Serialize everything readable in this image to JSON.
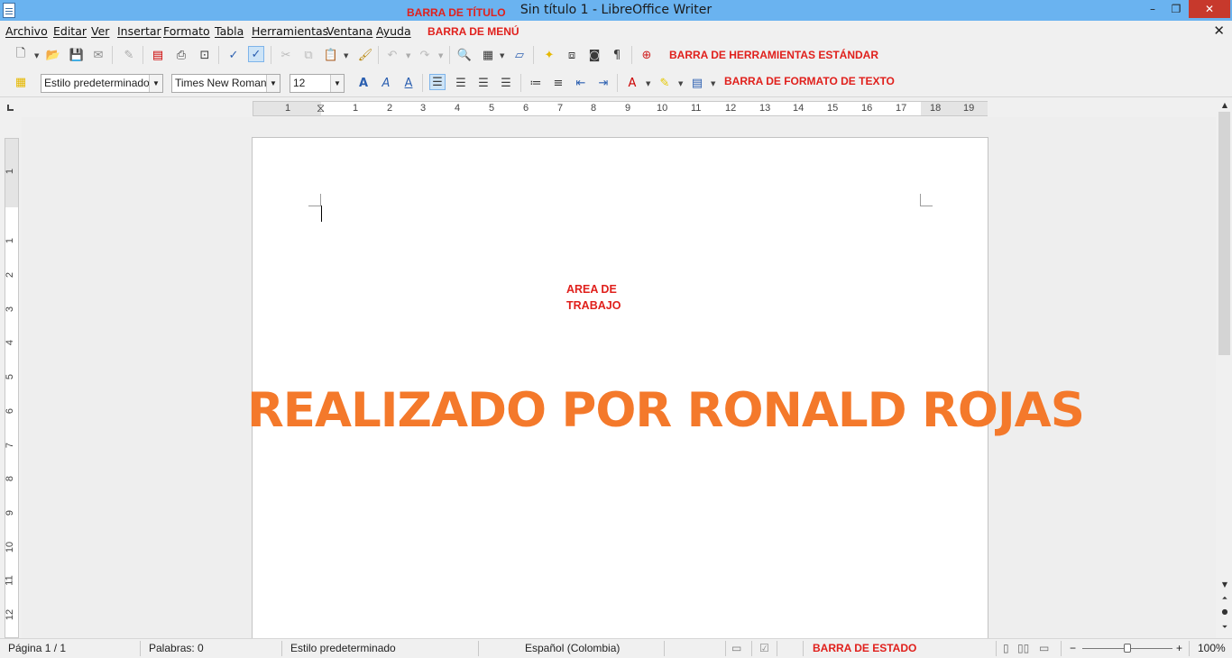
{
  "window": {
    "title": "Sin título 1 - LibreOffice Writer",
    "buttons": {
      "minimize": "–",
      "restore": "❐",
      "close": "✕"
    }
  },
  "annotations": {
    "title_bar": "BARRA DE TÍTULO",
    "menu_bar": "BARRA DE MENÚ",
    "standard_toolbar": "BARRA DE HERRAMIENTAS ESTÁNDAR",
    "format_toolbar": "BARRA DE FORMATO DE TEXTO",
    "work_area": [
      "AREA DE",
      "TRABAJO"
    ],
    "status_bar": "BARRA DE ESTADO",
    "watermark": "REALIZADO POR RONALD ROJAS"
  },
  "menu": {
    "items": [
      "Archivo",
      "Editar",
      "Ver",
      "Insertar",
      "Formato",
      "Tabla",
      "Herramientas",
      "Ventana",
      "Ayuda"
    ],
    "doc_close": "✕"
  },
  "format_toolbar": {
    "paragraph_style": "Estilo predeterminado",
    "font_name": "Times New Roman",
    "font_size": "12"
  },
  "ruler": {
    "horizontal_labels": [
      "1",
      "1",
      "2",
      "3",
      "4",
      "5",
      "6",
      "7",
      "8",
      "9",
      "10",
      "11",
      "12",
      "13",
      "14",
      "15",
      "16",
      "17",
      "18",
      "19"
    ],
    "vertical_labels": [
      "1",
      "1",
      "2",
      "3",
      "4",
      "5",
      "6",
      "7",
      "8",
      "9",
      "10",
      "11",
      "12"
    ]
  },
  "statusbar": {
    "page": "Página 1 / 1",
    "words": "Palabras: 0",
    "style": "Estilo predeterminado",
    "language": "Español (Colombia)",
    "zoom": "100%",
    "zoom_minus": "−",
    "zoom_plus": "+"
  },
  "colors": {
    "titlebar": "#6ab3f0",
    "annotation": "#e0201c",
    "watermark": "#f4792b",
    "close_button": "#c7392c"
  }
}
